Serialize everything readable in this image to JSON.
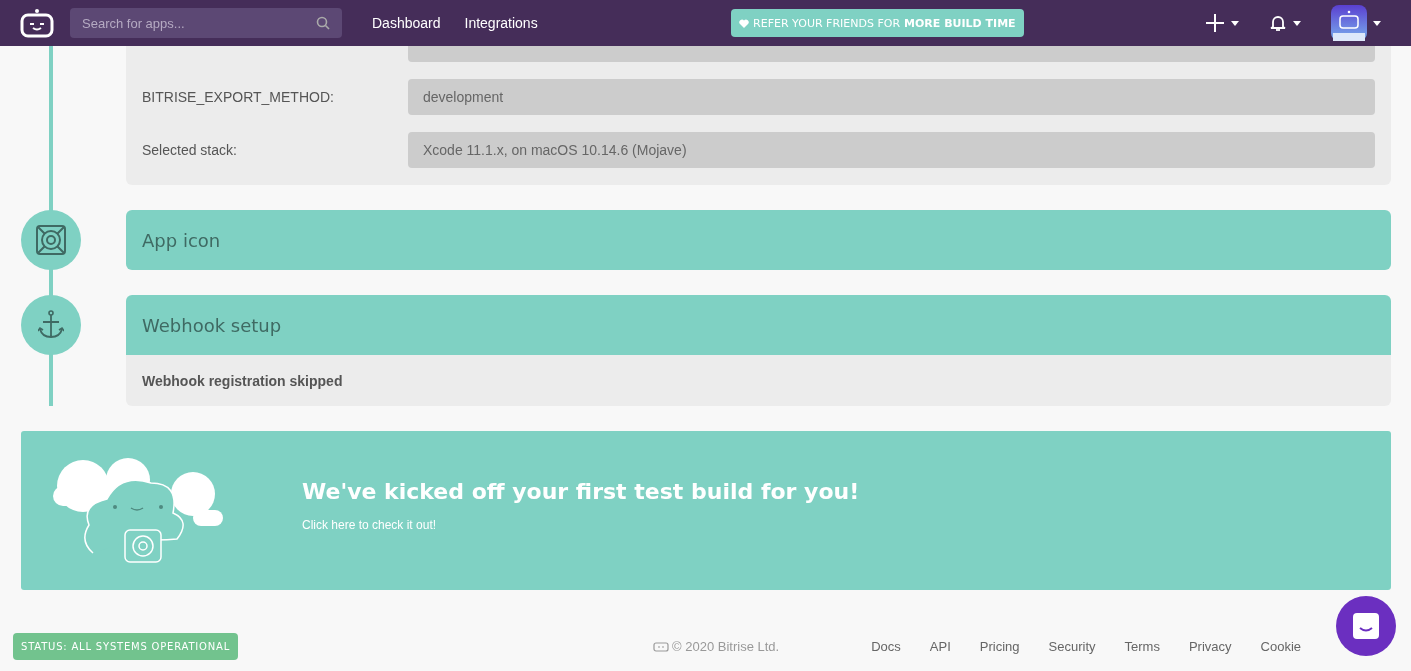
{
  "header": {
    "search": {
      "placeholder": "Search for apps..."
    },
    "nav": [
      {
        "label": "Dashboard"
      },
      {
        "label": "Integrations"
      }
    ],
    "referral": "REFER YOUR FRIENDS FOR **MORE BUILD TIME**"
  },
  "config_card": {
    "rows": [
      {
        "label": "",
        "value": ""
      },
      {
        "label": "BITRISE_EXPORT_METHOD:",
        "value": "development"
      },
      {
        "label": "Selected stack:",
        "value": "Xcode 11.1.x, on macOS 10.14.6 (Mojave)"
      }
    ]
  },
  "steps": [
    {
      "kind": "icon",
      "title": "App icon"
    },
    {
      "kind": "webhook",
      "title": "Webhook setup",
      "body": "Webhook registration skipped"
    }
  ],
  "banner": {
    "title": "We've kicked off your first test build for you!",
    "link": "Click here to check it out!"
  },
  "footer": {
    "status": "STATUS: ALL SYSTEMS OPERATIONAL",
    "copyright": "© 2020 Bitrise Ltd.",
    "links": [
      "Docs",
      "API",
      "Pricing",
      "Security",
      "Terms",
      "Privacy",
      "Cookie"
    ]
  }
}
